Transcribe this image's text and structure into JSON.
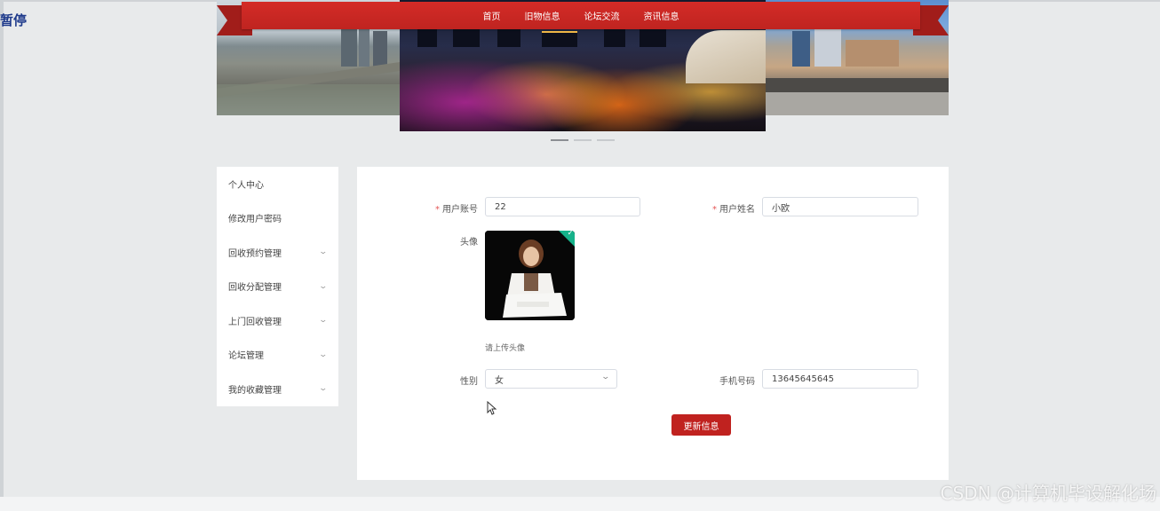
{
  "overlay": {
    "pause_label": "暂停"
  },
  "nav": {
    "items": [
      {
        "label": "首页"
      },
      {
        "label": "旧物信息"
      },
      {
        "label": "论坛交流"
      },
      {
        "label": "资讯信息"
      }
    ],
    "accent": "#c7231f"
  },
  "carousel": {
    "slide_count": 3,
    "active_index": 0
  },
  "sidebar": {
    "items": [
      {
        "label": "个人中心",
        "expandable": false
      },
      {
        "label": "修改用户密码",
        "expandable": false
      },
      {
        "label": "回收预约管理",
        "expandable": true
      },
      {
        "label": "回收分配管理",
        "expandable": true
      },
      {
        "label": "上门回收管理",
        "expandable": true
      },
      {
        "label": "论坛管理",
        "expandable": true
      },
      {
        "label": "我的收藏管理",
        "expandable": true
      }
    ]
  },
  "form": {
    "account_label": "用户账号",
    "account_value": "22",
    "name_label": "用户姓名",
    "name_value": "小欧",
    "avatar_label": "头像",
    "upload_tip": "请上传头像",
    "gender_label": "性别",
    "gender_value": "女",
    "phone_label": "手机号码",
    "phone_value": "13645645645",
    "required_mark": "*",
    "submit_label": "更新信息"
  },
  "watermark": {
    "text": "CSDN @计算机毕设解化场"
  }
}
